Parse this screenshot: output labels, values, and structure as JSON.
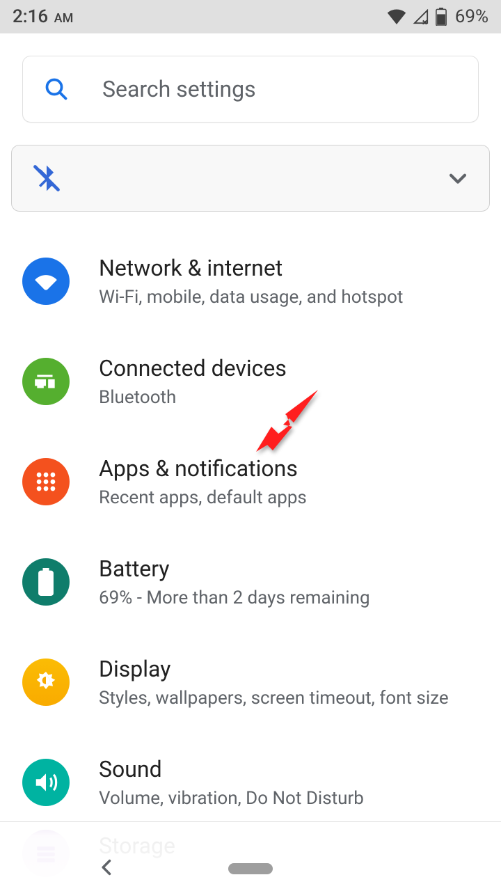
{
  "status": {
    "time": "2:16",
    "ampm": "AM",
    "battery_pct": "69%"
  },
  "search": {
    "placeholder": "Search settings"
  },
  "settings": [
    {
      "id": "network",
      "title": "Network & internet",
      "subtitle": "Wi-Fi, mobile, data usage, and hotspot",
      "color": "c-blue"
    },
    {
      "id": "devices",
      "title": "Connected devices",
      "subtitle": "Bluetooth",
      "color": "c-green"
    },
    {
      "id": "apps",
      "title": "Apps & notifications",
      "subtitle": "Recent apps, default apps",
      "color": "c-orange"
    },
    {
      "id": "battery",
      "title": "Battery",
      "subtitle": "69% - More than 2 days remaining",
      "color": "c-teal"
    },
    {
      "id": "display",
      "title": "Display",
      "subtitle": "Styles, wallpapers, screen timeout, font size",
      "color": "c-amber"
    },
    {
      "id": "sound",
      "title": "Sound",
      "subtitle": "Volume, vibration, Do Not Disturb",
      "color": "c-teal2"
    }
  ],
  "ghost": {
    "title": "Storage"
  }
}
